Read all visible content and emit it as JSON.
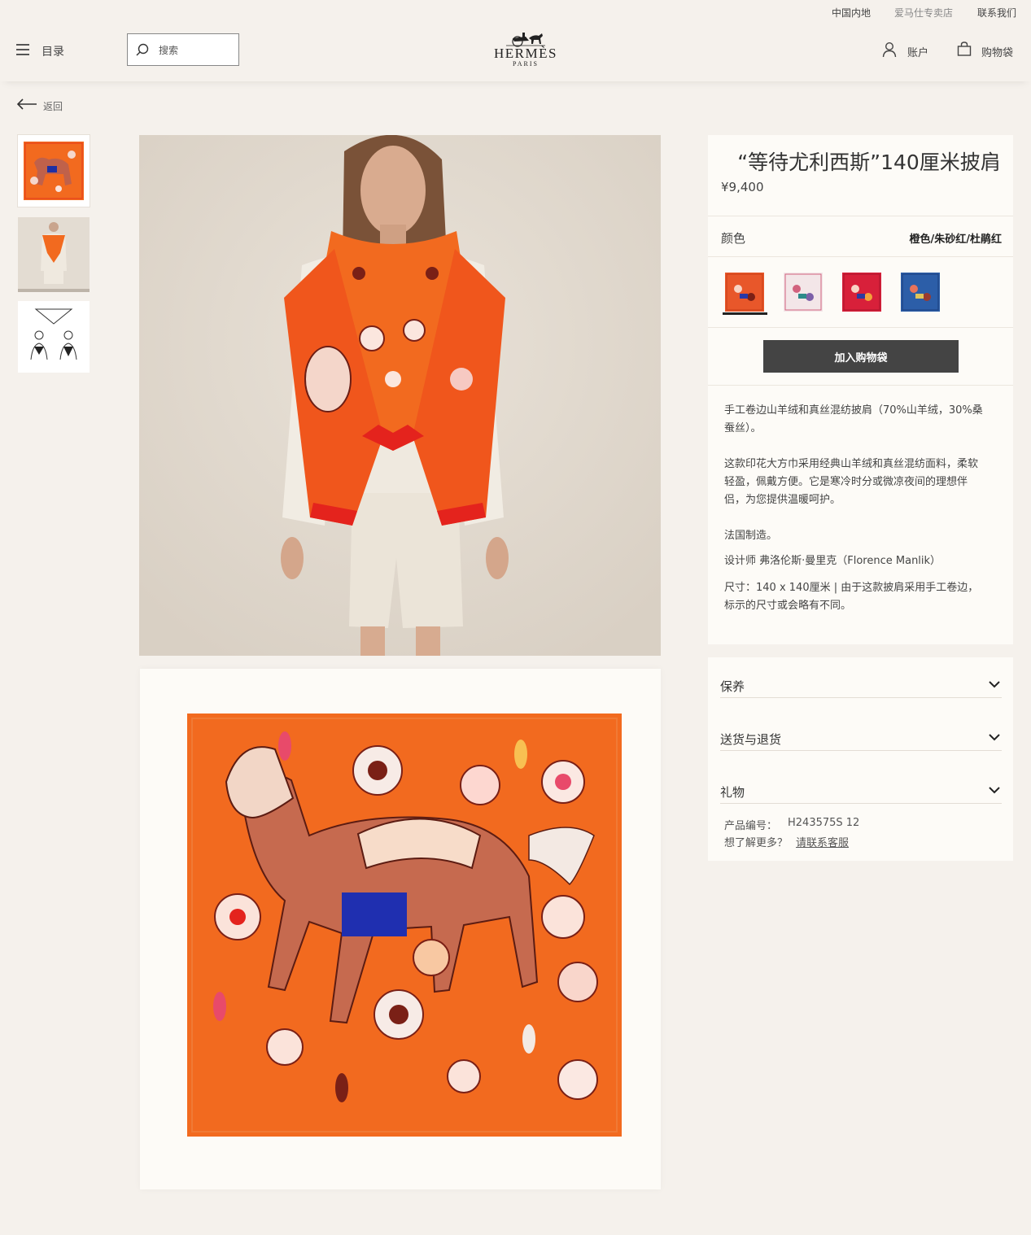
{
  "topbar": {
    "region": "中国内地",
    "stores": "爱马仕专卖店",
    "contact": "联系我们"
  },
  "header": {
    "menu_label": "目录",
    "search_placeholder": "搜索",
    "logo_text": "HERMÈS",
    "logo_sub": "PARIS",
    "account_label": "账户",
    "bag_label": "购物袋"
  },
  "nav": {
    "back_label": "返回"
  },
  "product": {
    "title": "“等待尤利西斯”140厘米披肩",
    "price": "¥9,400",
    "color_label": "颜色",
    "color_value": "橙色/朱砂红/杜鹃红",
    "swatches": [
      {
        "name": "orange",
        "color": "#e8572a",
        "selected": true
      },
      {
        "name": "pink",
        "color": "#f1e2e4",
        "selected": false
      },
      {
        "name": "red",
        "color": "#d8203a",
        "selected": false
      },
      {
        "name": "blue",
        "color": "#2c5ea8",
        "selected": false
      }
    ],
    "add_to_cart": "加入购物袋",
    "desc_lines": [
      "手工卷边山羊绒和真丝混纺披肩（70%山羊绒，30%桑",
      "蚕丝）。",
      "这款印花大方巾采用经典山羊绒和真丝混纺面料，柔软",
      "轻盈，佩戴方便。它是寒冷时分或微凉夜间的理想伴",
      "侣，为您提供温暖呵护。",
      "法国制造。",
      "设计师 弗洛伦斯·曼里克（Florence Manlik）",
      "尺寸：140 x 140厘米 | 由于这款披肩采用手工卷边，",
      "标示的尺寸或会略有不同。"
    ]
  },
  "accordion": {
    "care": "保养",
    "delivery": "送货与退货",
    "gift": "礼物"
  },
  "meta": {
    "sku_label": "产品编号：",
    "sku_value": "H243575S 12",
    "more_label": "想了解更多？",
    "more_link": "请联系客服"
  },
  "colors": {
    "page_bg": "#f5f1ec",
    "card_bg": "#fdfbf7",
    "scarf_orange": "#f26a1f",
    "button_dark": "#444444"
  }
}
